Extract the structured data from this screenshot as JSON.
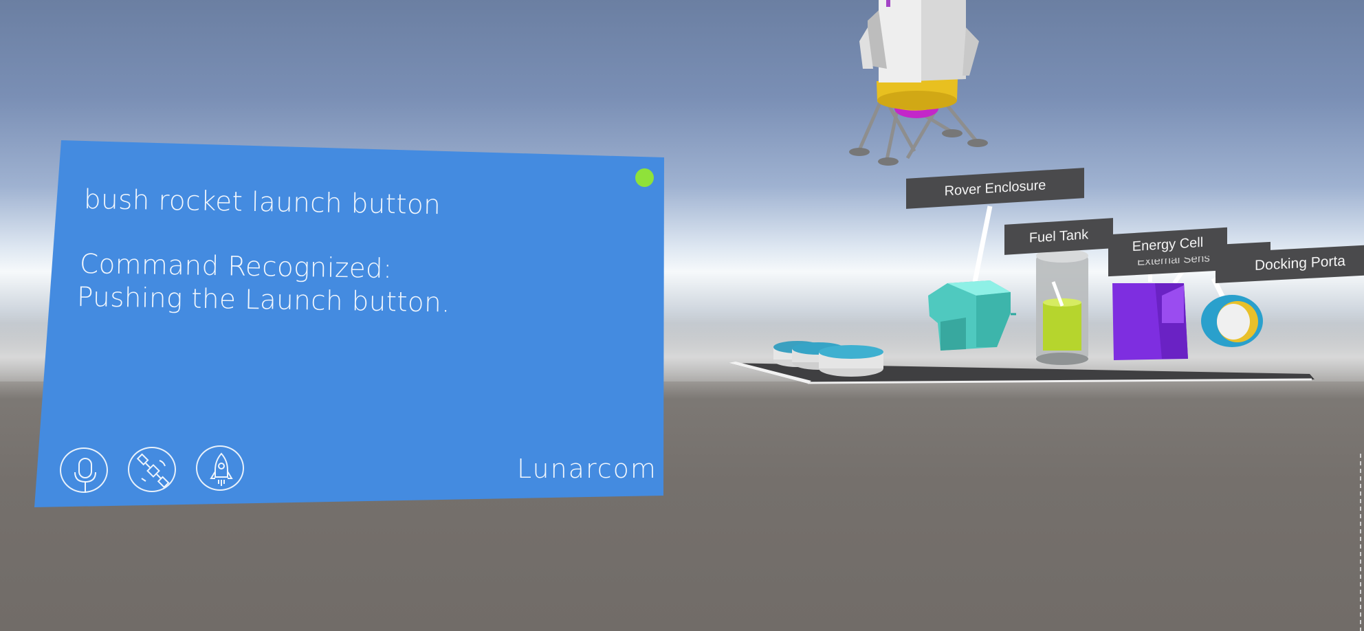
{
  "dialog": {
    "heard_text": "bush rocket launch button",
    "response_line1": "Command Recognized:",
    "response_line2": "Pushing the Launch button.",
    "brand": "Lunarcom",
    "status_color": "#8fe23a",
    "panel_color": "#448be0",
    "buttons": [
      {
        "icon": "microphone-icon"
      },
      {
        "icon": "satellite-icon"
      },
      {
        "icon": "rocket-icon"
      }
    ]
  },
  "scene_labels": {
    "rover_enclosure": "Rover Enclosure",
    "fuel_tank": "Fuel Tank",
    "energy_cell": "Energy Cell",
    "external_sensor": "External Sens",
    "docking_port": "Docking Porta"
  }
}
